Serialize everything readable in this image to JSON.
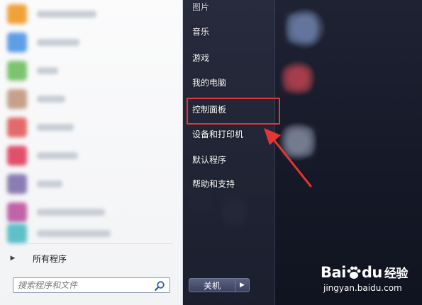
{
  "start_menu": {
    "all_programs_label": "所有程序",
    "search_placeholder": "搜索程序和文件",
    "right_items": [
      {
        "label": "图片"
      },
      {
        "label": "音乐"
      },
      {
        "label": "游戏"
      },
      {
        "label": "我的电脑"
      },
      {
        "label": "控制面板"
      },
      {
        "label": "设备和打印机"
      },
      {
        "label": "默认程序"
      },
      {
        "label": "帮助和支持"
      }
    ],
    "shutdown_label": "关机",
    "shutdown_more_icon": "triangle-right-icon",
    "highlighted_item": "控制面板"
  },
  "annotation": {
    "box_color": "#e53535",
    "arrow_color": "#e53535"
  },
  "watermark": {
    "site": "jingyan.baidu.com",
    "logo_text_bai": "Bai",
    "logo_text_du": "du",
    "logo_text_cn": "经验"
  }
}
